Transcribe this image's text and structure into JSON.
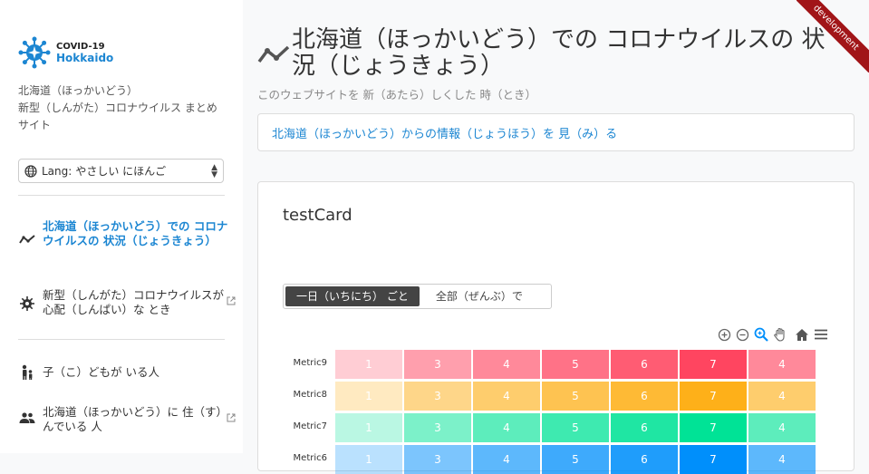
{
  "sidebar": {
    "logo": {
      "line1": "COVID-19",
      "line2": "Hokkaido"
    },
    "description": "北海道（ほっかいどう）\n新型（しんがた）コロナウイルス まとめサイト",
    "description_line1": "北海道（ほっかいどう）",
    "description_line2": "新型（しんがた）コロナウイルス まとめ",
    "description_line3": "サイト",
    "language": {
      "prefix": "Lang:",
      "selected": "やさしい にほんご"
    },
    "items": [
      {
        "label": "北海道（ほっかいどう）での コロナウイルスの 状況（じょうきょう）",
        "icon": "chart-line-icon",
        "active": true,
        "external": false
      },
      {
        "label": "新型（しんがた）コロナウイルスが 心配（しんぱい）な とき",
        "icon": "virus-icon",
        "active": false,
        "external": true
      },
      {
        "label": "子（こ）どもが いる人",
        "icon": "parent-child-icon",
        "active": false,
        "external": false
      },
      {
        "label": "北海道（ほっかいどう）に 住（す）んでいる 人",
        "icon": "people-icon",
        "active": false,
        "external": true
      }
    ]
  },
  "header": {
    "title": "北海道（ほっかいどう）での コロナウイルスの 状況（じょうきょう）",
    "subtitle": "このウェブサイトを 新（あたら）しくした 時（とき）"
  },
  "info_link": "北海道（ほっかいどう）からの情報（じょうほう）を 見（み）る",
  "card": {
    "title": "testCard",
    "toggle": {
      "daily": "一日（いちにち） ごと",
      "cumulative": "全部（ぜんぶ）で"
    },
    "toolbar_icons": [
      "zoom-in-icon",
      "zoom-out-icon",
      "zoom-select-icon",
      "pan-hand-icon",
      "home-icon",
      "menu-icon"
    ]
  },
  "ribbon": "development",
  "colors": {
    "accent": "#1c86d2",
    "ribbon": "#a11518"
  },
  "chart_data": {
    "type": "heatmap",
    "rows": [
      {
        "name": "Metric9",
        "values": [
          1,
          3,
          4,
          5,
          6,
          7,
          4
        ],
        "color": "#ff4560"
      },
      {
        "name": "Metric8",
        "values": [
          1,
          3,
          4,
          5,
          6,
          7,
          4
        ],
        "color": "#feb019"
      },
      {
        "name": "Metric7",
        "values": [
          1,
          3,
          4,
          5,
          6,
          7,
          4
        ],
        "color": "#00e396"
      },
      {
        "name": "Metric6",
        "values": [
          1,
          3,
          4,
          5,
          6,
          7,
          4
        ],
        "color": "#008ffb"
      }
    ]
  }
}
